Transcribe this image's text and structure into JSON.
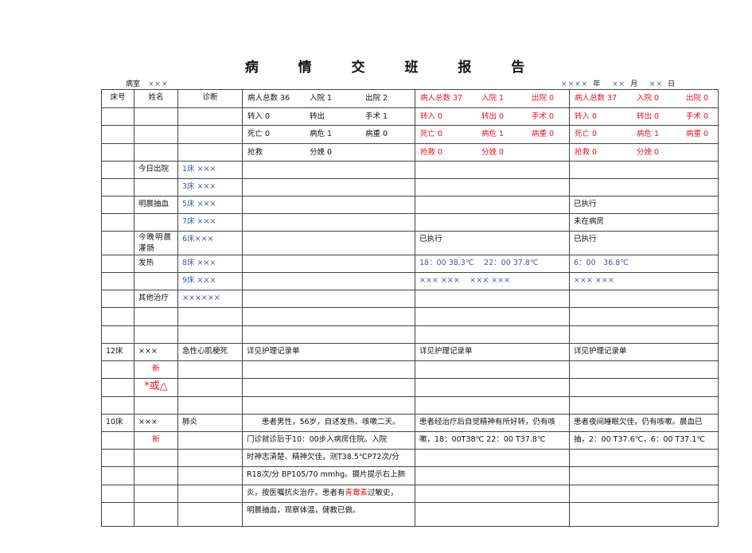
{
  "title": "病 情 交 班 报 告",
  "ward": {
    "label": "病室",
    "value": "×××"
  },
  "date": {
    "year": "××××",
    "year_unit": "年",
    "month": "××",
    "month_unit": "月",
    "day": "××",
    "day_unit": "日"
  },
  "colors": {
    "red": "#e8141e",
    "blue": "#3a5aa8"
  },
  "headers": [
    "床号",
    "姓名",
    "诊断"
  ],
  "shifts": [
    {
      "color": "black",
      "rows": [
        [
          "病人总数 36",
          "入院 1",
          "出院 2"
        ],
        [
          "转入 0",
          "转出",
          "手术 1"
        ],
        [
          "死亡 0",
          "病危 1",
          "病重 0"
        ],
        [
          "抢救",
          "分娩 0",
          ""
        ]
      ]
    },
    {
      "color": "red",
      "rows": [
        [
          "病人总数 37",
          "入院 1",
          "出院 0"
        ],
        [
          "转入 0",
          "转出 0",
          "手术 0"
        ],
        [
          "死亡 0",
          "病危 1",
          "病重 0"
        ],
        [
          "抢救 0",
          "分娩 0",
          ""
        ]
      ]
    },
    {
      "color": "red",
      "rows": [
        [
          "病人总数 37",
          "入院 0",
          "出院 0"
        ],
        [
          "转入 0",
          "转出 0",
          "手术 0"
        ],
        [
          "死亡 0",
          "病危 1",
          "病重 0"
        ],
        [
          "抢救 0",
          "分娩 0",
          ""
        ]
      ]
    }
  ],
  "rows": [
    {
      "cells": [
        "",
        "今日出院",
        "1床 ×××",
        "",
        "",
        ""
      ]
    },
    {
      "cells": [
        "",
        "",
        "3床 ×××",
        "",
        "",
        ""
      ]
    },
    {
      "cells": [
        "",
        "明晨抽血",
        "5床 ×××",
        "",
        "",
        "已执行"
      ]
    },
    {
      "cells": [
        "",
        "",
        "7床 ×××",
        "",
        "",
        "未在病房"
      ]
    },
    {
      "cells": [
        "",
        "今晚明晨灌肠",
        "6床×××",
        "",
        "已执行",
        "已执行"
      ]
    },
    {
      "cells": [
        "",
        "发热",
        "8床 ×××",
        "",
        "18：00 38.3℃　 22：00 37.8℃",
        "6：00　36.8℃"
      ]
    },
    {
      "cells": [
        "",
        "",
        "9床 ×××",
        "",
        "××× ×××　 ××× ×××",
        "××× ×××"
      ]
    },
    {
      "cells": [
        "",
        "其他治疗",
        "××××××",
        "",
        "",
        ""
      ]
    },
    {
      "cells": [
        "",
        "",
        "",
        "",
        "",
        ""
      ]
    },
    {
      "cells": [
        "",
        "",
        "",
        "",
        "",
        ""
      ]
    },
    {
      "cells": [
        "12床",
        "×××",
        "急性心肌梗死",
        "详见护理记录单",
        "详见护理记录单",
        "详见护理记录单"
      ]
    },
    {
      "cells": [
        "",
        "新",
        "",
        "",
        "",
        ""
      ]
    },
    {
      "cells": [
        "",
        "*或△",
        "",
        "",
        "",
        ""
      ]
    },
    {
      "cells": [
        "",
        "",
        "",
        "",
        "",
        ""
      ]
    },
    {
      "cells": [
        "10床",
        "×××",
        "肺炎",
        "　　患者男性，56岁，自述发热、咳嗽二天。",
        "患者经治疗后自觉精神有所好转，仍有咳",
        "患者夜间睡眠欠佳，仍有咳嗽。晨血已"
      ]
    },
    {
      "cells": [
        "",
        "新",
        "",
        "门诊就诊后于10：00步入病房住院。入院",
        "嗽，18：00T38℃ 22：00 T37.8℃",
        "抽，2：00 T37.6℃，6：00 T37.1℃"
      ]
    },
    {
      "cells": [
        "",
        "",
        "",
        "时神志清楚、精神欠佳，测T38.5℃P72次/分",
        "",
        ""
      ]
    },
    {
      "cells": [
        "",
        "",
        "",
        "R18次/分 BP105/70 mmhg。摄片提示右上肺",
        "",
        ""
      ]
    },
    {
      "cells": [
        "",
        "",
        "",
        [
          "炎，按医嘱抗炎治疗。患者有",
          "青霉素",
          "过敏史，"
        ],
        "",
        ""
      ]
    },
    {
      "cells": [
        "",
        "",
        "",
        "明晨抽血，观察体温，健教已做。",
        "",
        ""
      ]
    }
  ]
}
